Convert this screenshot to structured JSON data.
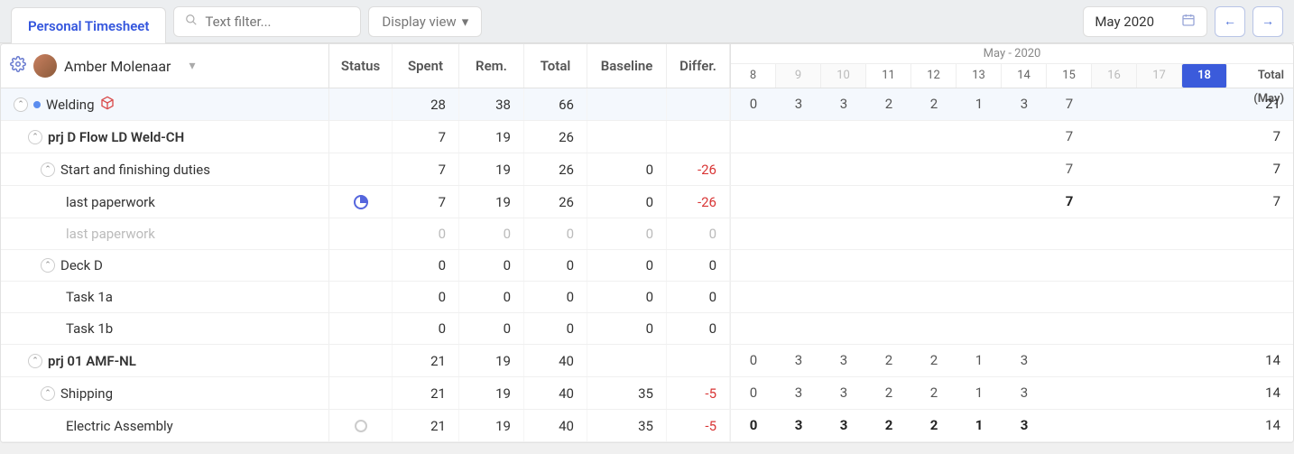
{
  "header": {
    "tab_label": "Personal Timesheet",
    "filter_placeholder": "Text filter...",
    "display_view": "Display view",
    "month": "May 2020",
    "month_header": "May - 2020"
  },
  "user": "Amber Molenaar",
  "cols": {
    "status": "Status",
    "spent": "Spent",
    "rem": "Rem.",
    "total": "Total",
    "baseline": "Baseline",
    "differ": "Differ.",
    "total_may": "Total (May)"
  },
  "days": [
    {
      "n": "8",
      "t": "n"
    },
    {
      "n": "9",
      "t": "wk"
    },
    {
      "n": "10",
      "t": "wk"
    },
    {
      "n": "11",
      "t": "n"
    },
    {
      "n": "12",
      "t": "n"
    },
    {
      "n": "13",
      "t": "n"
    },
    {
      "n": "14",
      "t": "n"
    },
    {
      "n": "15",
      "t": "n"
    },
    {
      "n": "16",
      "t": "wk"
    },
    {
      "n": "17",
      "t": "wk"
    },
    {
      "n": "18",
      "t": "today"
    }
  ],
  "rows": [
    {
      "name": "Welding",
      "indent": 0,
      "exp": true,
      "dot": true,
      "box": true,
      "bold": false,
      "top": true,
      "spent": "28",
      "rem": "38",
      "total": "66",
      "base": "",
      "diff": "",
      "d": [
        "0",
        "3",
        "3",
        "2",
        "2",
        "1",
        "3",
        "7",
        "",
        "",
        ""
      ],
      "tmay": "21"
    },
    {
      "name": "prj D Flow LD Weld-CH",
      "indent": 1,
      "exp": true,
      "bold": true,
      "spent": "7",
      "rem": "19",
      "total": "26",
      "base": "",
      "diff": "",
      "d": [
        "",
        "",
        "",
        "",
        "",
        "",
        "",
        "7",
        "",
        "",
        ""
      ],
      "tmay": "7"
    },
    {
      "name": "Start and finishing duties",
      "indent": 2,
      "exp": true,
      "spent": "7",
      "rem": "19",
      "total": "26",
      "base": "0",
      "diff": "-26",
      "diffneg": true,
      "d": [
        "",
        "",
        "",
        "",
        "",
        "",
        "",
        "7",
        "",
        "",
        ""
      ],
      "tmay": "7"
    },
    {
      "name": "last paperwork",
      "indent": 3,
      "status": "pie",
      "spent": "7",
      "rem": "19",
      "total": "26",
      "base": "0",
      "diff": "-26",
      "diffneg": true,
      "d": [
        "",
        "",
        "",
        "",
        "",
        "",
        "",
        "7",
        "",
        "",
        ""
      ],
      "dbold": true,
      "tmay": "7"
    },
    {
      "name": "last paperwork",
      "indent": 3,
      "faded": true,
      "spent": "0",
      "rem": "0",
      "total": "0",
      "base": "0",
      "diff": "0",
      "allgray": true,
      "d": [
        "",
        "",
        "",
        "",
        "",
        "",
        "",
        "",
        "",
        "",
        ""
      ],
      "tmay": ""
    },
    {
      "name": "Deck D",
      "indent": 2,
      "exp": true,
      "spent": "0",
      "rem": "0",
      "total": "0",
      "base": "0",
      "diff": "0",
      "d": [
        "",
        "",
        "",
        "",
        "",
        "",
        "",
        "",
        "",
        "",
        ""
      ],
      "tmay": ""
    },
    {
      "name": "Task 1a",
      "indent": 3,
      "spent": "0",
      "rem": "0",
      "total": "0",
      "base": "0",
      "diff": "0",
      "d": [
        "",
        "",
        "",
        "",
        "",
        "",
        "",
        "",
        "",
        "",
        ""
      ],
      "tmay": ""
    },
    {
      "name": "Task 1b",
      "indent": 3,
      "spent": "0",
      "rem": "0",
      "total": "0",
      "base": "0",
      "diff": "0",
      "d": [
        "",
        "",
        "",
        "",
        "",
        "",
        "",
        "",
        "",
        "",
        ""
      ],
      "tmay": ""
    },
    {
      "name": "prj 01 AMF-NL",
      "indent": 1,
      "exp": true,
      "bold": true,
      "spent": "21",
      "rem": "19",
      "total": "40",
      "base": "",
      "diff": "",
      "d": [
        "0",
        "3",
        "3",
        "2",
        "2",
        "1",
        "3",
        "",
        "",
        "",
        ""
      ],
      "tmay": "14"
    },
    {
      "name": "Shipping",
      "indent": 2,
      "exp": true,
      "spent": "21",
      "rem": "19",
      "total": "40",
      "base": "35",
      "diff": "-5",
      "diffneg": true,
      "d": [
        "0",
        "3",
        "3",
        "2",
        "2",
        "1",
        "3",
        "",
        "",
        "",
        ""
      ],
      "tmay": "14"
    },
    {
      "name": "Electric Assembly",
      "indent": 3,
      "status": "circ",
      "spent": "21",
      "rem": "19",
      "total": "40",
      "base": "35",
      "diff": "-5",
      "diffneg": true,
      "d": [
        "0",
        "3",
        "3",
        "2",
        "2",
        "1",
        "3",
        "",
        "",
        "",
        ""
      ],
      "dbold": true,
      "tmay": "14"
    }
  ]
}
